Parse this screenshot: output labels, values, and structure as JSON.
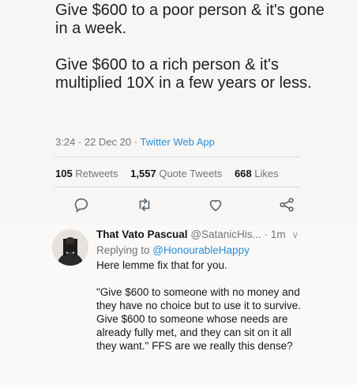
{
  "tweet": {
    "paragraph1": "Give $600 to a poor person & it's gone in a week.",
    "paragraph2": "Give $600 to a rich person & it's multiplied 10X in a few years or less.",
    "timestamp": "3:24 · 22 Dec 20 · ",
    "source": "Twitter Web App",
    "stats": {
      "retweets_count": "105",
      "retweets_label": "Retweets",
      "quotes_count": "1,557",
      "quotes_label": "Quote Tweets",
      "likes_count": "668",
      "likes_label": "Likes"
    },
    "actions": [
      "reply-icon",
      "retweet-icon",
      "like-icon",
      "share-icon"
    ]
  },
  "reply": {
    "name": "That Vato Pascual",
    "handle": "@SatanicHis...",
    "time": "· 1m",
    "replying_prefix": "Replying to ",
    "replying_to": "@HonourableHappy",
    "text": "Here lemme fix that for you.",
    "quote": "\"Give $600 to someone with no money and they have no choice but to use it to survive. Give $600 to someone whose needs are already fully met, and they can sit on it all they want.\" FFS are we really this dense?"
  },
  "colors": {
    "link": "#2b8fd6",
    "muted": "#6e767d",
    "text": "#14171a"
  }
}
